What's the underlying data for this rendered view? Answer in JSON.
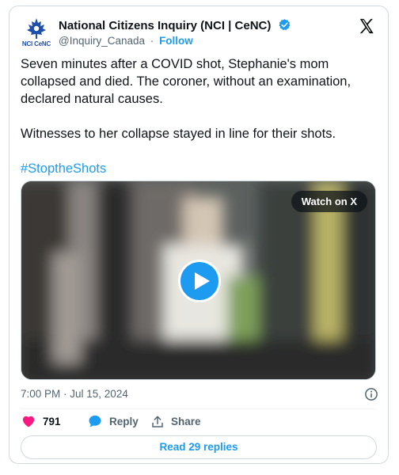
{
  "author": {
    "display_name": "National Citizens Inquiry (NCI | CeNC)",
    "logo_text": "NCI CeNC",
    "handle": "@Inquiry_Canada",
    "separator": "·",
    "follow_label": "Follow"
  },
  "post": {
    "paragraph1": "Seven minutes after a COVID shot, Stephanie's mom collapsed and died. The coroner, without an examination, declared natural causes.",
    "paragraph2": "Witnesses to her collapse stayed in line for their shots.",
    "hashtag": "#StoptheShots"
  },
  "media": {
    "watch_label": "Watch on X"
  },
  "meta": {
    "timestamp": "7:00 PM · Jul 15, 2024"
  },
  "actions": {
    "like_count": "791",
    "reply_label": "Reply",
    "share_label": "Share"
  },
  "footer": {
    "read_replies_label": "Read 29 replies"
  },
  "colors": {
    "accent": "#1d9bf0",
    "like": "#f91880",
    "text": "#0f1419",
    "muted": "#536471",
    "border": "#cfd9de"
  }
}
